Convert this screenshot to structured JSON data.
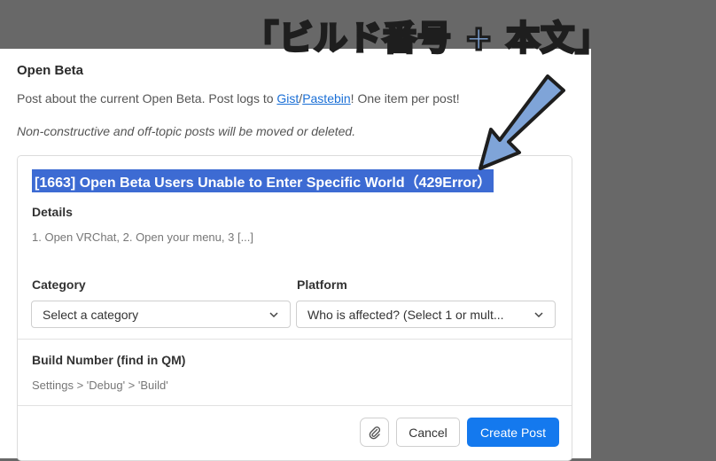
{
  "panel": {
    "title": "Open Beta",
    "description": {
      "before": "Post about the current Open Beta. Post logs to ",
      "link1": "Gist",
      "sep": "/",
      "link2": "Pastebin",
      "after": "! One item per post!"
    },
    "note": "Non-constructive and off-topic posts will be moved or deleted."
  },
  "form": {
    "post_title": "[1663] Open Beta Users Unable to Enter Specific World（429Error）",
    "details_label": "Details",
    "details_placeholder": "1. Open VRChat, 2. Open your menu, 3 [...]",
    "category_label": "Category",
    "category_value": "Select a category",
    "platform_label": "Platform",
    "platform_value": "Who is affected? (Select 1 or mult...",
    "build_label": "Build Number (find in QM)",
    "build_placeholder": "Settings > 'Debug' > 'Build'"
  },
  "actions": {
    "attach_icon": "paperclip-icon",
    "cancel_label": "Cancel",
    "create_label": "Create Post"
  },
  "annotation": {
    "text": "「ビルド番号 + 本文」"
  },
  "colors": {
    "background": "#686868",
    "primary": "#1479ee",
    "highlight": "#3d6bd3",
    "annotation": "#7fa4d8"
  }
}
